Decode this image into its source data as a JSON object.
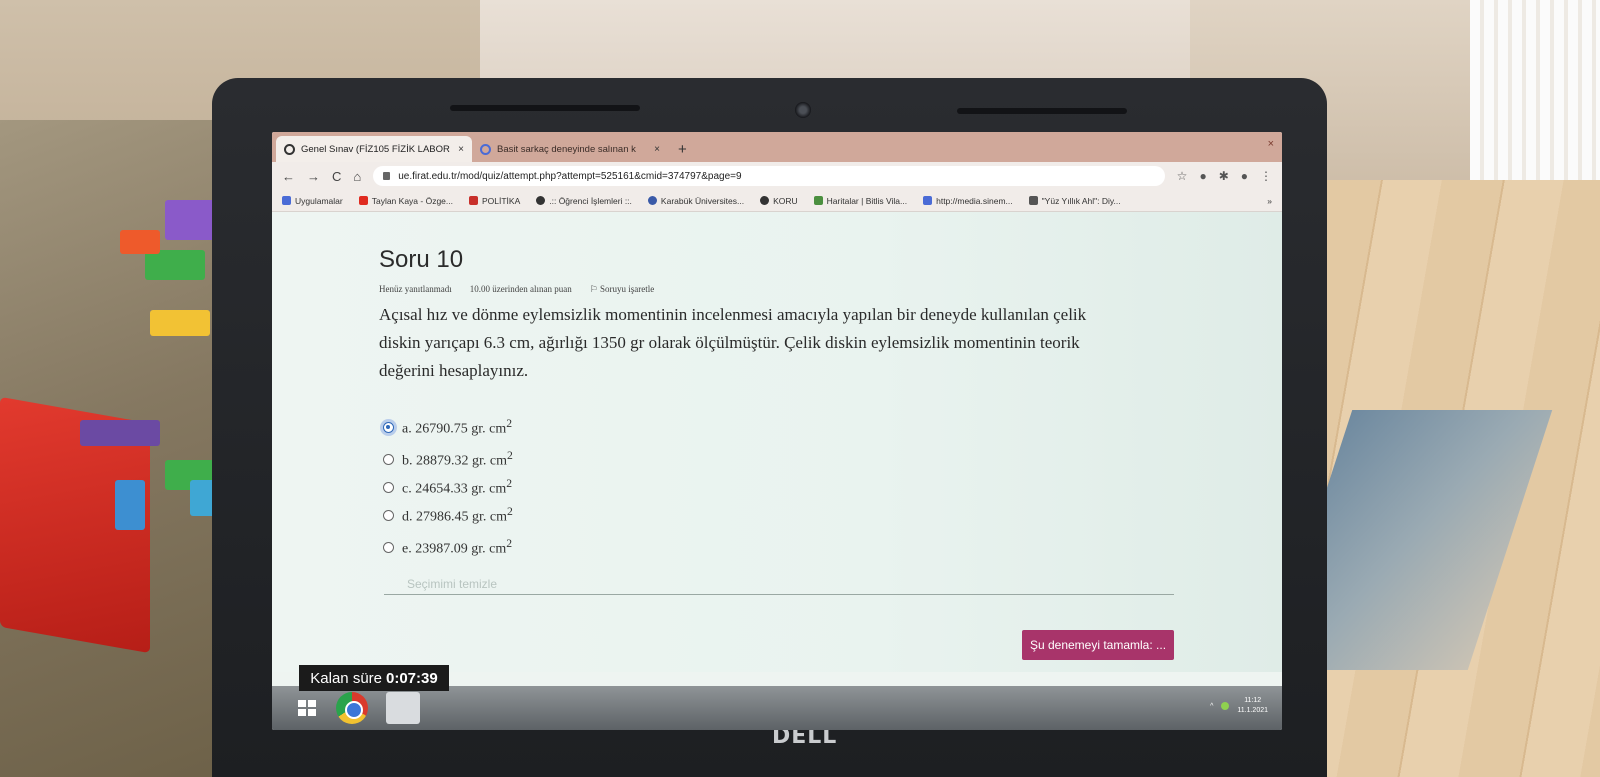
{
  "browser": {
    "tabs": [
      {
        "title": "Genel Sınav (FİZ105 FİZİK LABOR",
        "close": "×"
      },
      {
        "title": "Basit sarkaç deneyinde salınan k",
        "close": "×"
      }
    ],
    "new_tab": "+",
    "window_close": "×",
    "nav": {
      "back": "←",
      "forward": "→",
      "reload": "C",
      "home": "⌂"
    },
    "url": "ue.firat.edu.tr/mod/quiz/attempt.php?attempt=525161&cmid=374797&page=9",
    "toolbar_icons": [
      "☆",
      "●",
      "✱",
      "●",
      "⋮"
    ]
  },
  "bookmarks": [
    {
      "label": "Uygulamalar",
      "color": "#4a6bd6"
    },
    {
      "label": "Taylan Kaya - Özge...",
      "color": "#e02b20"
    },
    {
      "label": "POLİTİKA",
      "color": "#c8302b"
    },
    {
      "label": ".:: Öğrenci İşlemleri ::.",
      "color": "#333333"
    },
    {
      "label": "Karabük Üniversites...",
      "color": "#3a5aa8"
    },
    {
      "label": "KORU",
      "color": "#333333"
    },
    {
      "label": "Haritalar | Bitlis Vila...",
      "color": "#4b8f3f"
    },
    {
      "label": "http://media.sinem...",
      "color": "#4a6bd6"
    },
    {
      "label": "\"Yüz Yıllık Ahl\": Diy...",
      "color": "#555555"
    }
  ],
  "bookmarks_more": "»",
  "quiz": {
    "title": "Soru 10",
    "status": "Henüz yanıtlanmadı",
    "points": "10.00 üzerinden alınan puan",
    "flag": "Soruyu işaretle",
    "question": "Açısal hız ve dönme eylemsizlik momentinin incelenmesi amacıyla yapılan bir deneyde kullanılan çelik diskin yarıçapı 6.3 cm, ağırlığı 1350 gr olarak ölçülmüştür. Çelik diskin eylemsizlik momentinin teorik değerini hesaplayınız.",
    "answers": [
      {
        "label": "a. 26790.75 gr. cm",
        "sup": "2",
        "selected": true
      },
      {
        "label": "b. 28879.32 gr. cm",
        "sup": "2",
        "selected": false
      },
      {
        "label": "c. 24654.33 gr. cm",
        "sup": "2",
        "selected": false
      },
      {
        "label": "d. 27986.45 gr. cm",
        "sup": "2",
        "selected": false
      },
      {
        "label": "e. 23987.09 gr. cm",
        "sup": "2",
        "selected": false
      }
    ],
    "clear_choice": "Seçimimi temizle",
    "finish_button": "Şu denemeyi tamamla: ..."
  },
  "timer": {
    "label": "Kalan süre",
    "value": "0:07:39"
  },
  "taskbar": {
    "time": "11:12",
    "date": "11.1.2021",
    "tray_arrow": "^"
  },
  "device": {
    "brand": "DELL"
  }
}
